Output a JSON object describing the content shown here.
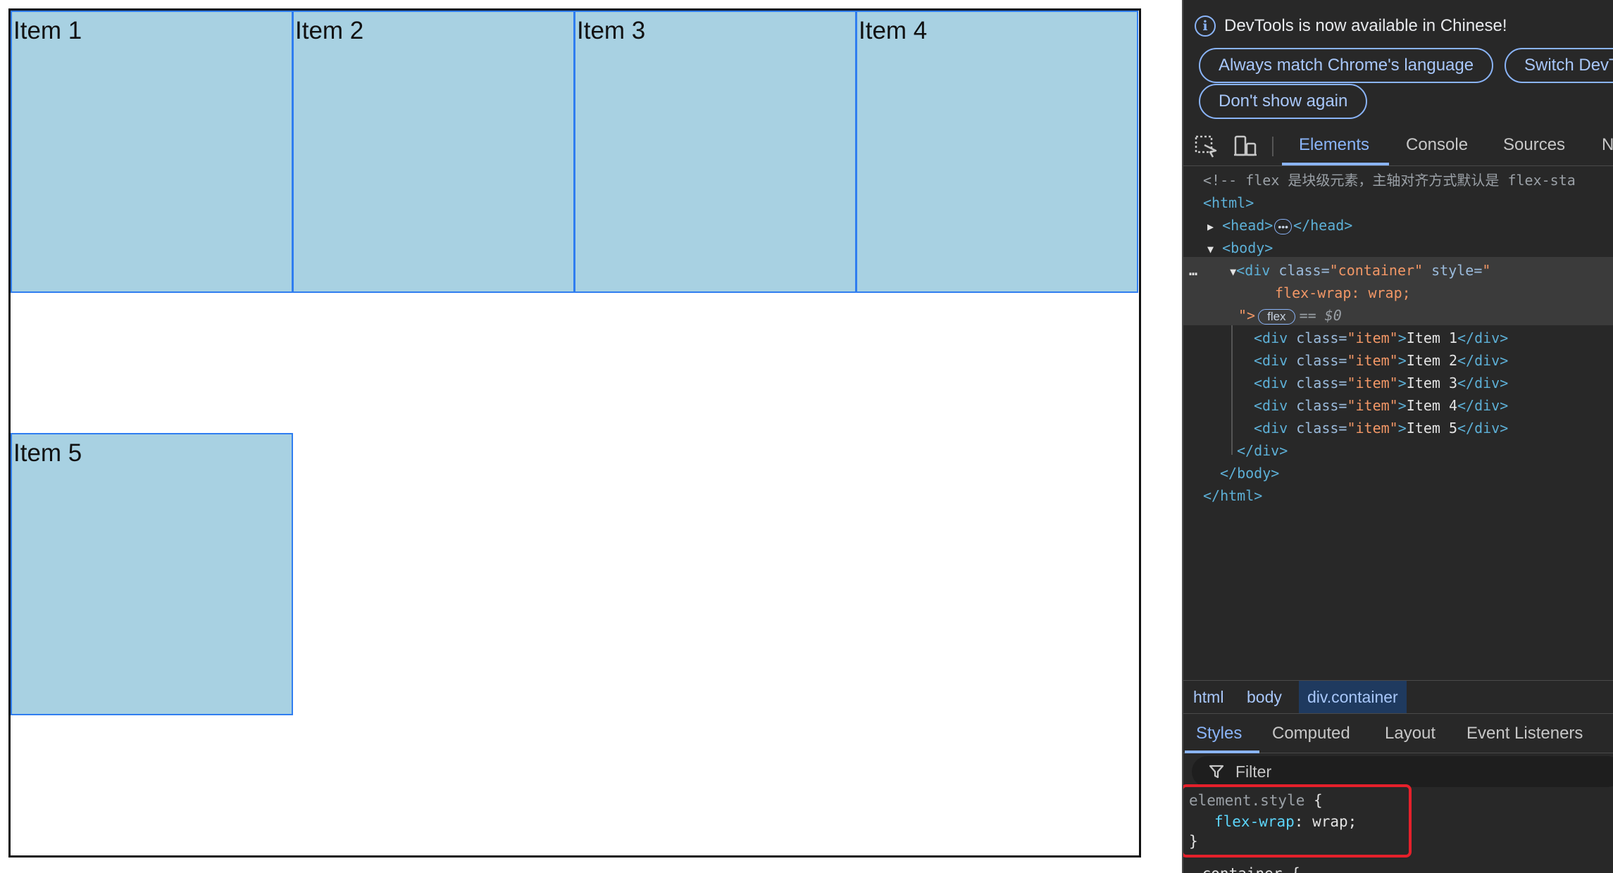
{
  "page": {
    "items": [
      "Item 1",
      "Item 2",
      "Item 3",
      "Item 4",
      "Item 5"
    ]
  },
  "devtools": {
    "notice": {
      "text": "DevTools is now available in Chinese!",
      "icon": "info-icon",
      "buttons": [
        "Always match Chrome's language",
        "Switch DevT",
        "Don't show again"
      ]
    },
    "toolbar": {
      "icons": [
        "inspect-element-icon",
        "device-toggle-icon"
      ],
      "tabs": [
        "Elements",
        "Console",
        "Sources",
        "N"
      ],
      "active_tab": "Elements"
    },
    "dom": {
      "comment": "<!-- flex 是块级元素，主轴对齐方式默认是 flex-sta",
      "html_open": "<html>",
      "head_open": "<head>",
      "head_close": "</head>",
      "body_open": "<body>",
      "div_tag": "<div",
      "attr_class": "class=",
      "attr_class_val": "\"container\"",
      "attr_style": "style=",
      "attr_style_open": "\"",
      "style_prop": "flex-wrap: wrap;",
      "style_close": "\">",
      "flex_badge": "flex",
      "dollar": "== $0",
      "ellipsis": "…",
      "children": [
        {
          "open": "<div",
          "attr": " class=",
          "val": "\"item\"",
          "close_open": ">",
          "text": "Item 1",
          "end": "</div>"
        },
        {
          "open": "<div",
          "attr": " class=",
          "val": "\"item\"",
          "close_open": ">",
          "text": "Item 2",
          "end": "</div>"
        },
        {
          "open": "<div",
          "attr": " class=",
          "val": "\"item\"",
          "close_open": ">",
          "text": "Item 3",
          "end": "</div>"
        },
        {
          "open": "<div",
          "attr": " class=",
          "val": "\"item\"",
          "close_open": ">",
          "text": "Item 4",
          "end": "</div>"
        },
        {
          "open": "<div",
          "attr": " class=",
          "val": "\"item\"",
          "close_open": ">",
          "text": "Item 5",
          "end": "</div>"
        }
      ],
      "div_close": "</div>",
      "body_close": "</body>",
      "html_close": "</html>"
    },
    "breadcrumbs": [
      "html",
      "body",
      "div.container"
    ],
    "active_breadcrumb": "div.container",
    "style_tabs": [
      "Styles",
      "Computed",
      "Layout",
      "Event Listeners"
    ],
    "active_style_tab": "Styles",
    "filter_placeholder": "Filter",
    "rules": {
      "element_style_selector": "element.style",
      "open_brace": " {",
      "prop": "flex-wrap",
      "colon": ": ",
      "value": "wrap",
      "semicolon": ";",
      "close_brace": "}",
      "next_selector": ".container {"
    },
    "highlight_color": "#e5202b",
    "accent_color": "#8ab4f8"
  }
}
